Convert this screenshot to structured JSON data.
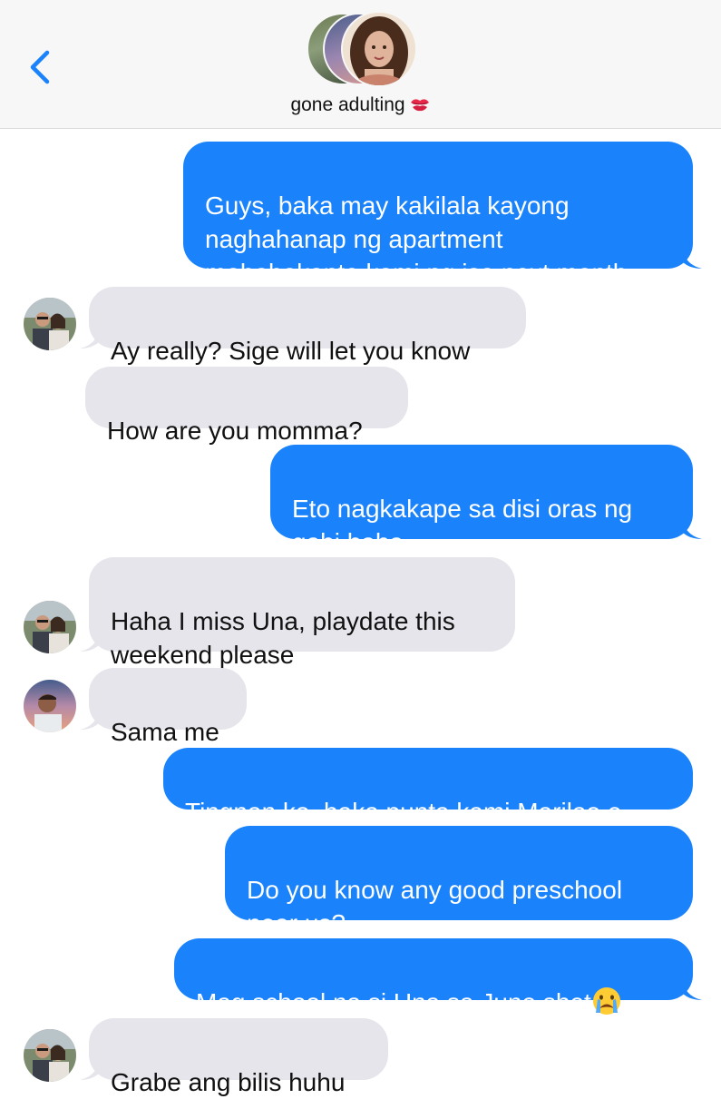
{
  "header": {
    "back_icon": "chevron-left-icon",
    "group_name": "gone adulting",
    "group_emoji": "kiss-mark-icon",
    "accent": "#1a82fb"
  },
  "messages": [
    {
      "dir": "out",
      "text": "Guys, baka may kakilala kayong\nnaghahanap ng apartment\nmababakante kami ng isa next month"
    },
    {
      "dir": "in",
      "sender_avatar": "couple-avatar",
      "text": "Ay really? Sige will let you know"
    },
    {
      "dir": "in",
      "text": "How are you momma?"
    },
    {
      "dir": "out",
      "text": "Eto nagkakape sa disi oras ng\ngabi haha"
    },
    {
      "dir": "in",
      "sender_avatar": "couple-avatar",
      "text": "Haha I miss Una, playdate this\nweekend please"
    },
    {
      "dir": "in",
      "sender_avatar": "man-sunset-avatar",
      "text": "Sama me"
    },
    {
      "dir": "out",
      "text": "Tingnan ko, baka punta kami Marilao e"
    },
    {
      "dir": "out",
      "text": "Do you know any good preschool\nnear us?"
    },
    {
      "dir": "out",
      "text": "Mag school na si Una sa June shet",
      "emoji": "crying-face-icon"
    },
    {
      "dir": "in",
      "sender_avatar": "couple-avatar",
      "text": "Grabe ang bilis huhu"
    }
  ],
  "colors": {
    "outgoing_bubble": "#1a82fb",
    "incoming_bubble": "#e6e5eb",
    "header_bg": "#f7f7f7"
  }
}
